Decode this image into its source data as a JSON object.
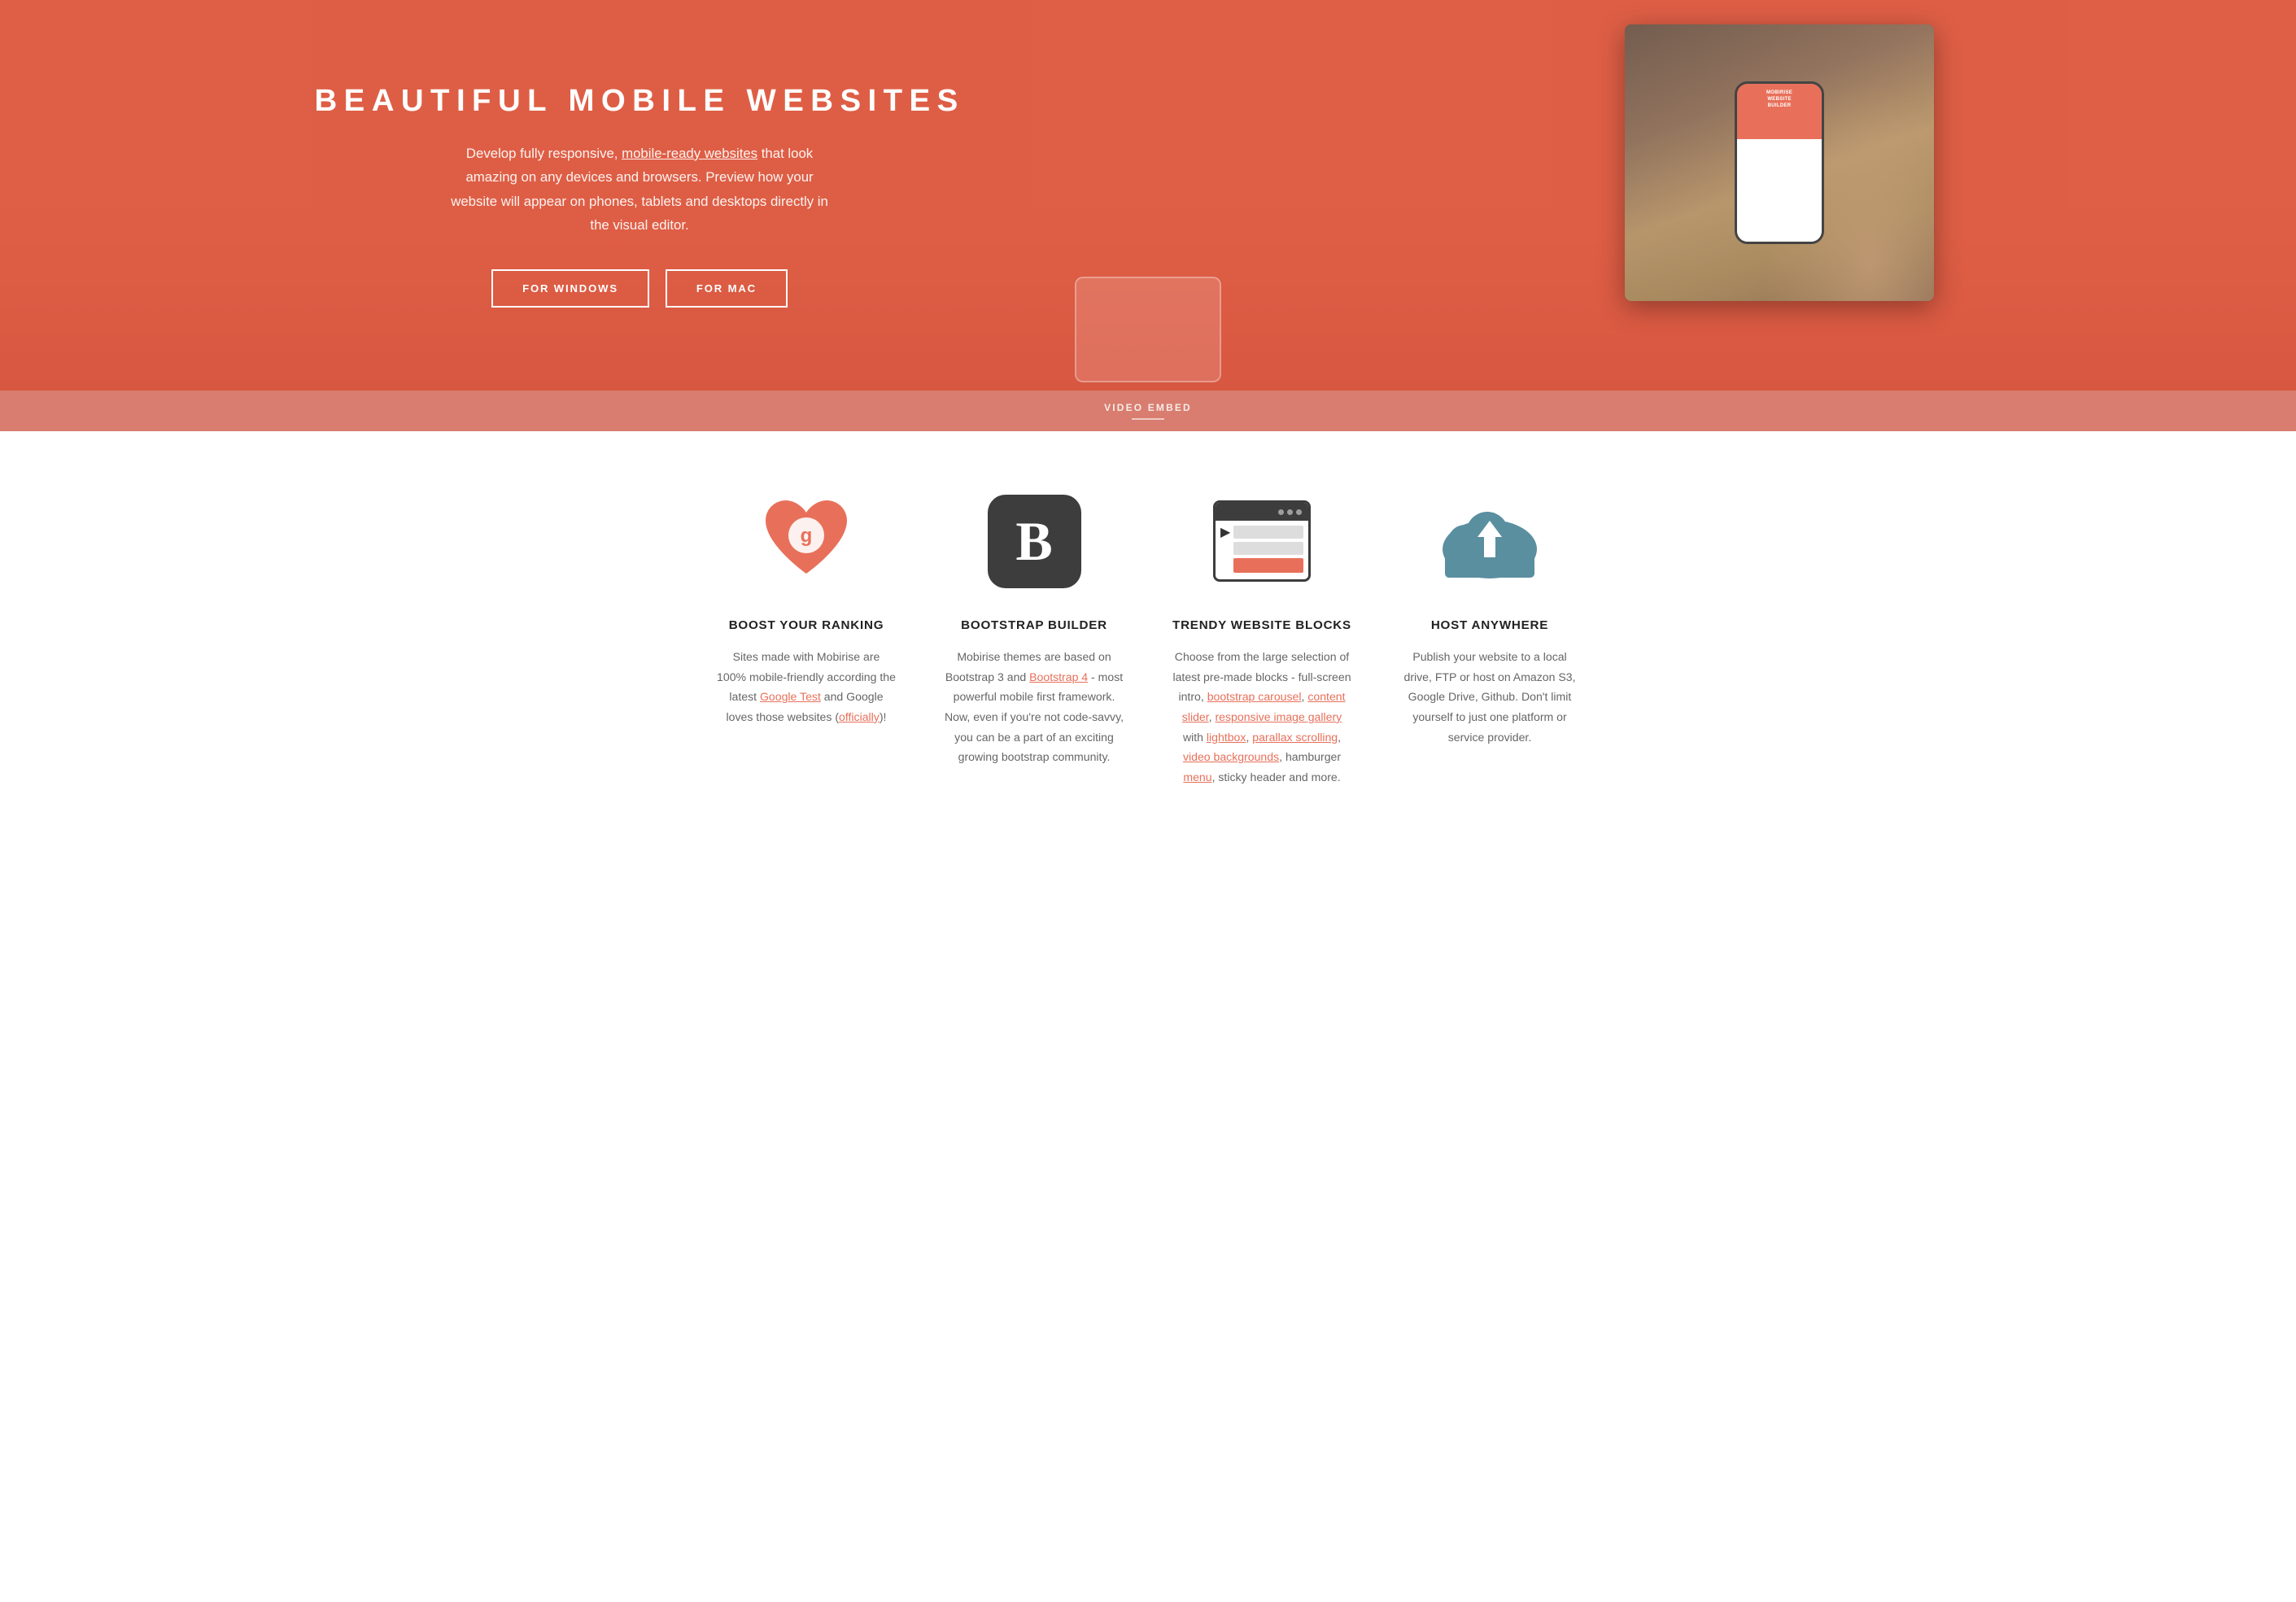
{
  "hero": {
    "title": "BEAUTIFUL MOBILE WEBSITES",
    "description_prefix": "Develop fully responsive, ",
    "description_link": "mobile-ready websites",
    "description_suffix": " that look amazing on any devices and browsers. Preview how your website will appear on phones, tablets and desktops directly in the visual editor.",
    "btn_windows": "FOR WINDOWS",
    "btn_mac": "FOR MAC",
    "video_embed_label": "VIDEO EMBED"
  },
  "features": {
    "col1": {
      "icon_label": "google-heart-icon",
      "title": "BOOST YOUR RANKING",
      "desc_parts": [
        "Sites made with Mobirise are 100% mobile-friendly according the latest ",
        "Google Test",
        " and Google loves those websites (",
        "officially",
        ")!"
      ]
    },
    "col2": {
      "icon_label": "bootstrap-icon",
      "title": "BOOTSTRAP BUILDER",
      "desc_parts": [
        "Mobirise themes are based on Bootstrap 3 and ",
        "Bootstrap 4",
        " - most powerful mobile first framework. Now, even if you're not code-savvy, you can be a part of an exciting growing bootstrap community."
      ]
    },
    "col3": {
      "icon_label": "browser-blocks-icon",
      "title": "TRENDY WEBSITE BLOCKS",
      "desc_parts": [
        "Choose from the large selection of latest pre-made blocks - full-screen intro, ",
        "bootstrap carousel",
        ", ",
        "content slider",
        ", ",
        "responsive image gallery",
        " with ",
        "lightbox",
        ", ",
        "parallax scrolling",
        ", ",
        "video backgrounds",
        ", hamburger ",
        "menu",
        ", sticky header and more."
      ]
    },
    "col4": {
      "icon_label": "cloud-upload-icon",
      "title": "HOST ANYWHERE",
      "desc": "Publish your website to a local drive, FTP or host on Amazon S3, Google Drive, Github. Don't limit yourself to just one platform or service provider."
    }
  }
}
